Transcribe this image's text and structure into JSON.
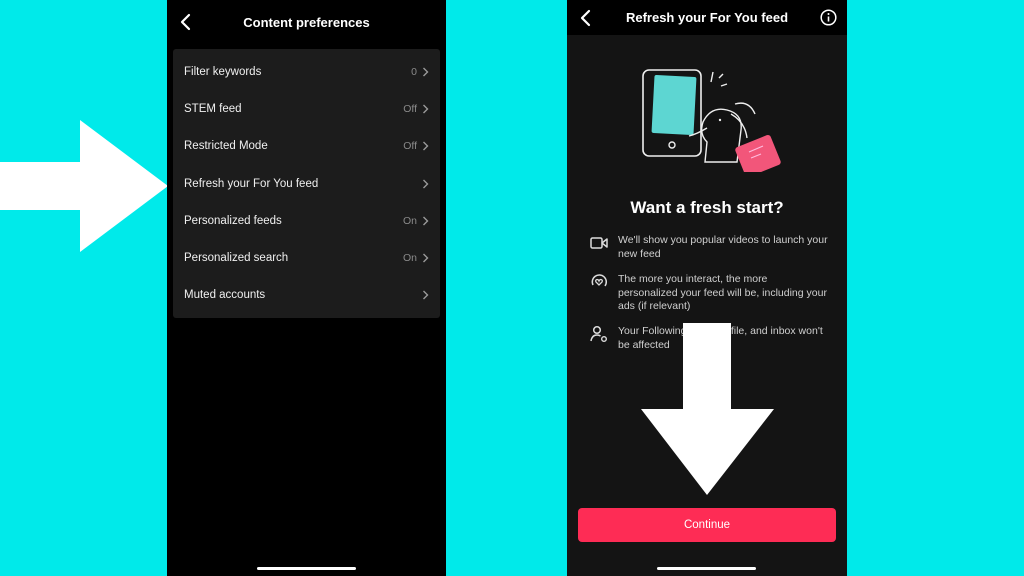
{
  "colors": {
    "background": "#00eaea",
    "accent": "#fe2c55",
    "illustration_screen": "#5dd6d2",
    "illustration_tag": "#f2567a"
  },
  "left_screen": {
    "title": "Content preferences",
    "back_icon": "chevron-left-icon",
    "items": [
      {
        "label": "Filter keywords",
        "value": "0"
      },
      {
        "label": "STEM feed",
        "value": "Off"
      },
      {
        "label": "Restricted Mode",
        "value": "Off"
      },
      {
        "label": "Refresh your For You feed",
        "value": ""
      },
      {
        "label": "Personalized feeds",
        "value": "On"
      },
      {
        "label": "Personalized search",
        "value": "On"
      },
      {
        "label": "Muted accounts",
        "value": ""
      }
    ]
  },
  "right_screen": {
    "title": "Refresh your For You feed",
    "back_icon": "chevron-left-icon",
    "info_icon": "info-icon",
    "headline": "Want a fresh start?",
    "bullets": [
      {
        "icon": "video-camera-icon",
        "text": "We'll show you popular videos to launch your new feed"
      },
      {
        "icon": "heart-refresh-icon",
        "text": "The more you interact, the more personalized your feed will be, including your ads (if relevant)"
      },
      {
        "icon": "user-settings-icon",
        "text": "Your Following feed, profile, and inbox won't be affected"
      }
    ],
    "continue_label": "Continue"
  },
  "annotations": {
    "right_arrow": "pointing to Refresh your For You feed",
    "down_arrow": "pointing to Continue button"
  }
}
